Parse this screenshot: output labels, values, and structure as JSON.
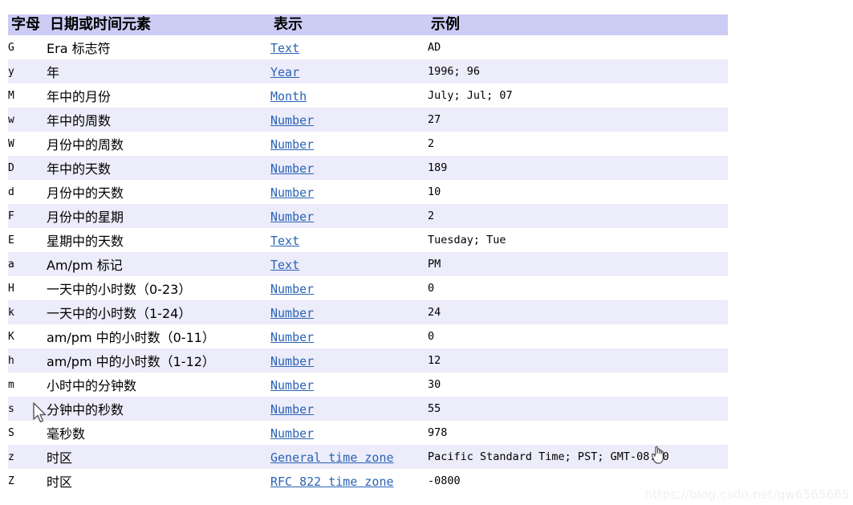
{
  "table": {
    "headers": {
      "letter": "字母",
      "element": "日期或时间元素",
      "representation": "表示",
      "example": "示例"
    },
    "rows": [
      {
        "letter": "G",
        "element": "Era 标志符",
        "repr": "Text",
        "example": "AD"
      },
      {
        "letter": "y",
        "element": "年",
        "repr": "Year",
        "example": "1996; 96"
      },
      {
        "letter": "M",
        "element": "年中的月份",
        "repr": "Month",
        "example": "July; Jul; 07"
      },
      {
        "letter": "w",
        "element": "年中的周数",
        "repr": "Number",
        "example": "27"
      },
      {
        "letter": "W",
        "element": "月份中的周数",
        "repr": "Number",
        "example": "2"
      },
      {
        "letter": "D",
        "element": "年中的天数",
        "repr": "Number",
        "example": "189"
      },
      {
        "letter": "d",
        "element": "月份中的天数",
        "repr": "Number",
        "example": "10"
      },
      {
        "letter": "F",
        "element": "月份中的星期",
        "repr": "Number",
        "example": "2"
      },
      {
        "letter": "E",
        "element": "星期中的天数",
        "repr": "Text",
        "example": "Tuesday; Tue"
      },
      {
        "letter": "a",
        "element": "Am/pm 标记",
        "repr": "Text",
        "example": "PM"
      },
      {
        "letter": "H",
        "element": "一天中的小时数（0-23）",
        "repr": "Number",
        "example": "0"
      },
      {
        "letter": "k",
        "element": "一天中的小时数（1-24）",
        "repr": "Number",
        "example": "24"
      },
      {
        "letter": "K",
        "element": "am/pm 中的小时数（0-11）",
        "repr": "Number",
        "example": "0"
      },
      {
        "letter": "h",
        "element": "am/pm 中的小时数（1-12）",
        "repr": "Number",
        "example": "12"
      },
      {
        "letter": "m",
        "element": "小时中的分钟数",
        "repr": "Number",
        "example": "30"
      },
      {
        "letter": "s",
        "element": "分钟中的秒数",
        "repr": "Number",
        "example": "55"
      },
      {
        "letter": "S",
        "element": "毫秒数",
        "repr": "Number",
        "example": "978"
      },
      {
        "letter": "z",
        "element": "时区",
        "repr": "General time zone",
        "example": "Pacific Standard Time; PST; GMT-08:00"
      },
      {
        "letter": "Z",
        "element": "时区",
        "repr": "RFC 822 time zone",
        "example": "-0800"
      }
    ]
  },
  "watermark": {
    "text": "https://blog.csdn.net/qw6565665"
  },
  "colors": {
    "header_background": "#ccccf5",
    "band_background": "#ececfa",
    "link": "#2a63b5",
    "text": "#000000",
    "watermark": "#f0f0f0"
  }
}
